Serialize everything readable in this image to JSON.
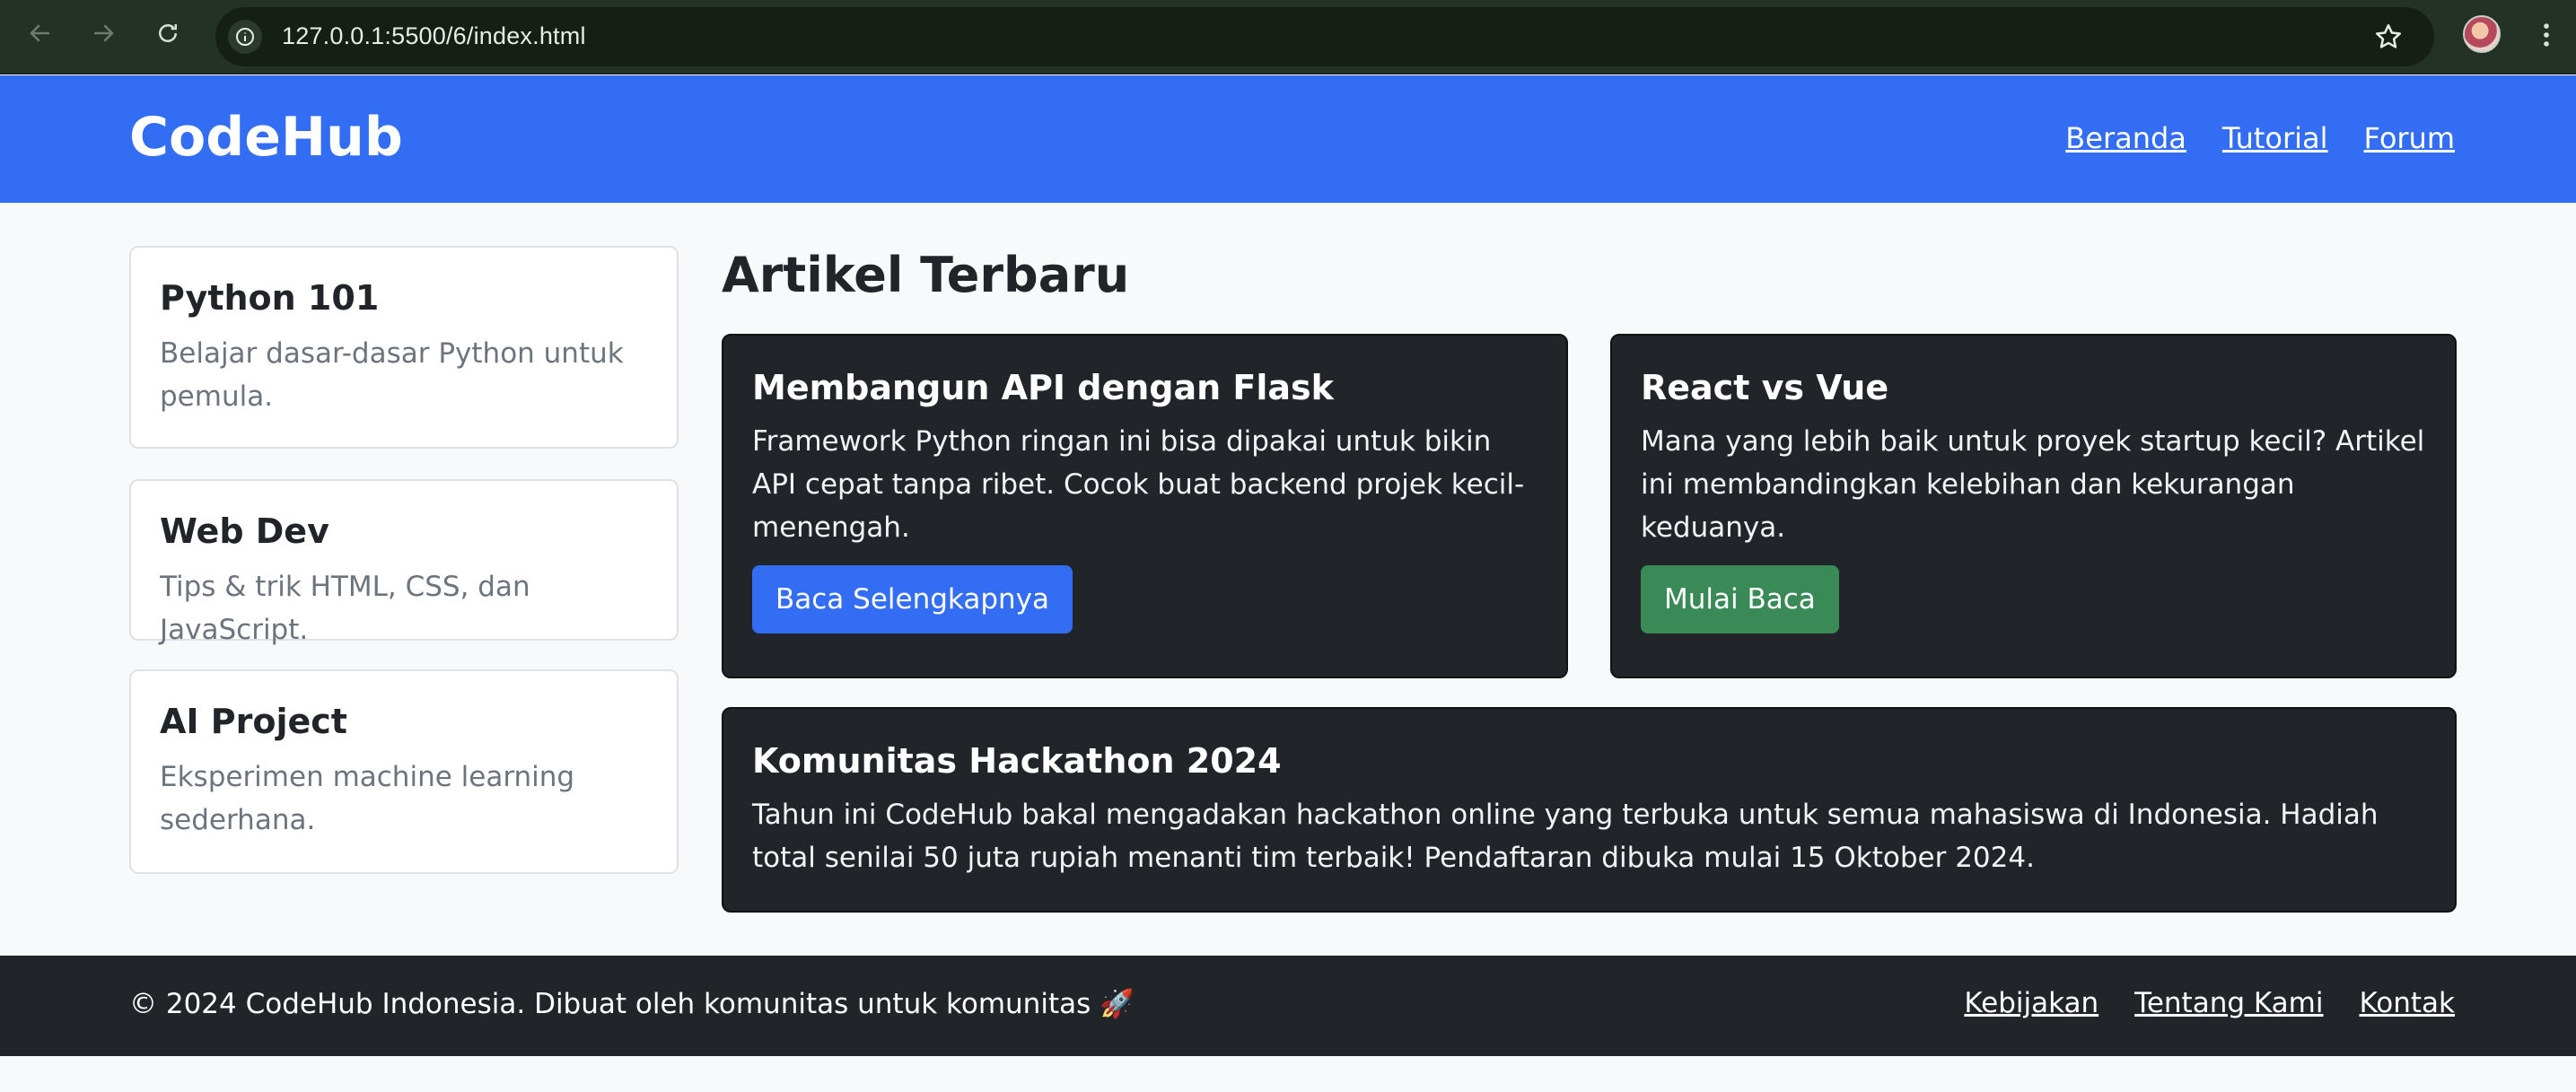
{
  "browser": {
    "url": "127.0.0.1:5500/6/index.html"
  },
  "navbar": {
    "brand": "CodeHub",
    "links": [
      "Beranda",
      "Tutorial",
      "Forum"
    ],
    "bg_color": "#336df3"
  },
  "sidebar": {
    "cards": [
      {
        "title": "Python 101",
        "text": "Belajar dasar-dasar Python untuk pemula."
      },
      {
        "title": "Web Dev",
        "text": "Tips & trik HTML, CSS, dan JavaScript."
      },
      {
        "title": "AI Project",
        "text": "Eksperimen machine learning sederhana."
      }
    ]
  },
  "main": {
    "section_title": "Artikel Terbaru",
    "articles": [
      {
        "title": "Membangun API dengan Flask",
        "text": "Framework Python ringan ini bisa dipakai untuk bikin API cepat tanpa ribet. Cocok buat backend projek kecil-menengah.",
        "button": "Baca Selengkapnya",
        "button_color": "#336df3"
      },
      {
        "title": "React vs Vue",
        "text": "Mana yang lebih baik untuk proyek startup kecil? Artikel ini membandingkan kelebihan dan kekurangan keduanya.",
        "button": "Mulai Baca",
        "button_color": "#3a8a57"
      },
      {
        "title": "Komunitas Hackathon 2024",
        "text": "Tahun ini CodeHub bakal mengadakan hackathon online yang terbuka untuk semua mahasiswa di Indonesia. Hadiah total senilai 50 juta rupiah menanti tim terbaik! Pendaftaran dibuka mulai 15 Oktober 2024."
      }
    ]
  },
  "footer": {
    "text": "© 2024 CodeHub Indonesia. Dibuat oleh komunitas untuk komunitas 🚀",
    "links": [
      "Kebijakan",
      "Tentang Kami",
      "Kontak"
    ]
  }
}
